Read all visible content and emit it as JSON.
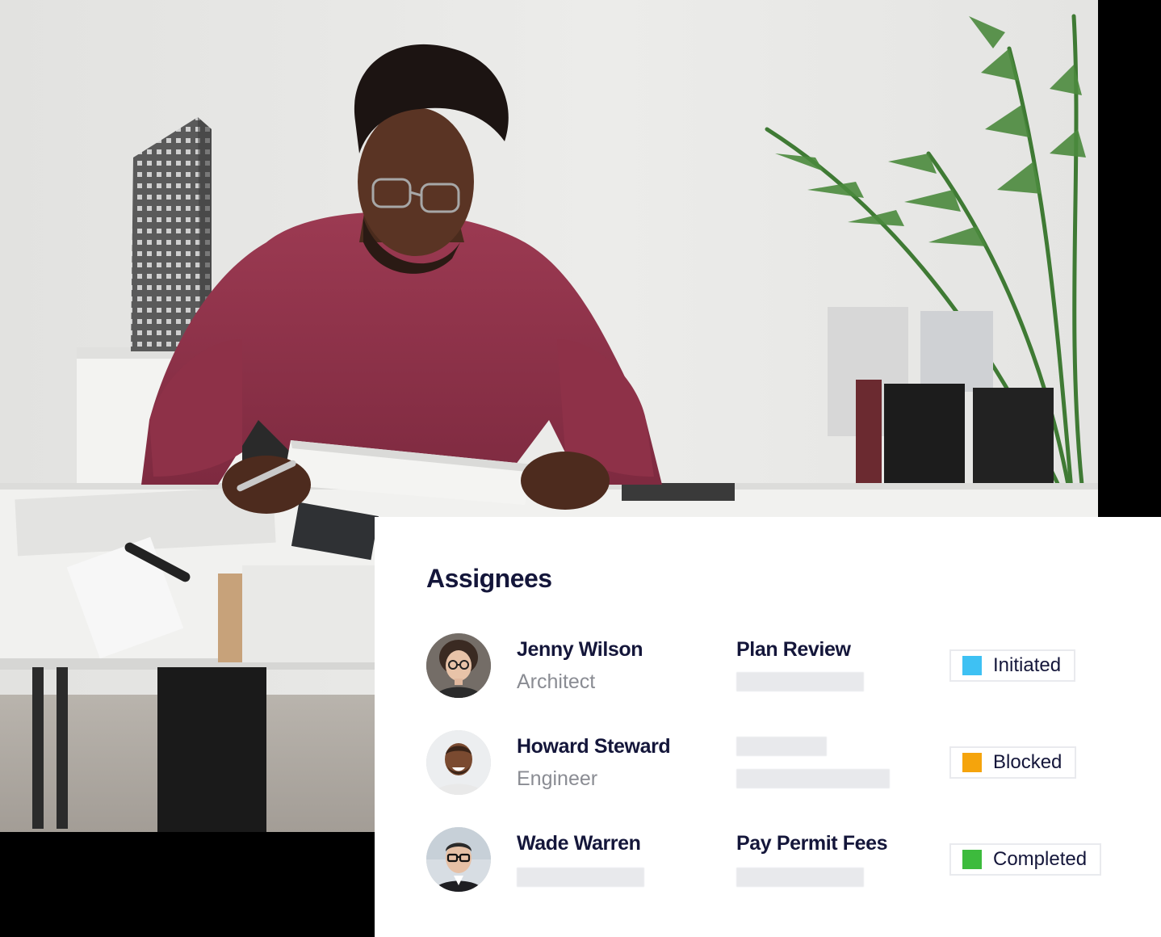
{
  "card": {
    "title": "Assignees"
  },
  "assignees": [
    {
      "name": "Jenny Wilson",
      "role": "Architect",
      "task": "Plan Review",
      "status": {
        "label": "Initiated",
        "color": "#3ec1f3"
      }
    },
    {
      "name": "Howard Steward",
      "role": "Engineer",
      "task": "",
      "status": {
        "label": "Blocked",
        "color": "#f5a40c"
      }
    },
    {
      "name": "Wade Warren",
      "role": "",
      "task": "Pay Permit Fees",
      "status": {
        "label": "Completed",
        "color": "#3dbb3d"
      }
    }
  ],
  "colors": {
    "heading": "#14163a",
    "muted": "#8a8c93",
    "placeholder": "#e8e9ec"
  },
  "photo": {
    "subject": "man-reviewing-documents-icon"
  }
}
